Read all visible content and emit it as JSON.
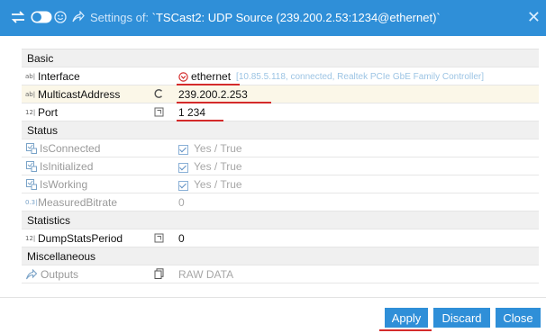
{
  "window": {
    "title_prefix": "Settings of: ",
    "title": "`TSCast2: UDP Source (239.200.2.53:1234@ethernet)`",
    "close_glyph": "✕"
  },
  "groups": {
    "basic": "Basic",
    "status": "Status",
    "statistics": "Statistics",
    "misc": "Miscellaneous"
  },
  "rows": {
    "interface": {
      "name": "Interface",
      "type": "ab|",
      "value": "ethernet",
      "hint": "[10.85.5.118, connected, Realtek PCIe GbE Family Controller]"
    },
    "multicast": {
      "name": "MulticastAddress",
      "type": "ab|",
      "value": "239.200.2.253"
    },
    "port": {
      "name": "Port",
      "type": "12|",
      "value": "1 234"
    },
    "isconnected": {
      "name": "IsConnected",
      "value": "Yes / True"
    },
    "isinitialized": {
      "name": "IsInitialized",
      "value": "Yes / True"
    },
    "isworking": {
      "name": "IsWorking",
      "value": "Yes / True"
    },
    "bitrate": {
      "name": "MeasuredBitrate",
      "type": "0.3|",
      "value": "0"
    },
    "dumpstats": {
      "name": "DumpStatsPeriod",
      "type": "12|",
      "value": "0"
    },
    "outputs": {
      "name": "Outputs",
      "value": "RAW DATA"
    }
  },
  "buttons": {
    "apply": "Apply",
    "discard": "Discard",
    "close": "Close"
  },
  "colors": {
    "titlebar": "#2f8fd8",
    "annotation": "#d42b2b"
  }
}
